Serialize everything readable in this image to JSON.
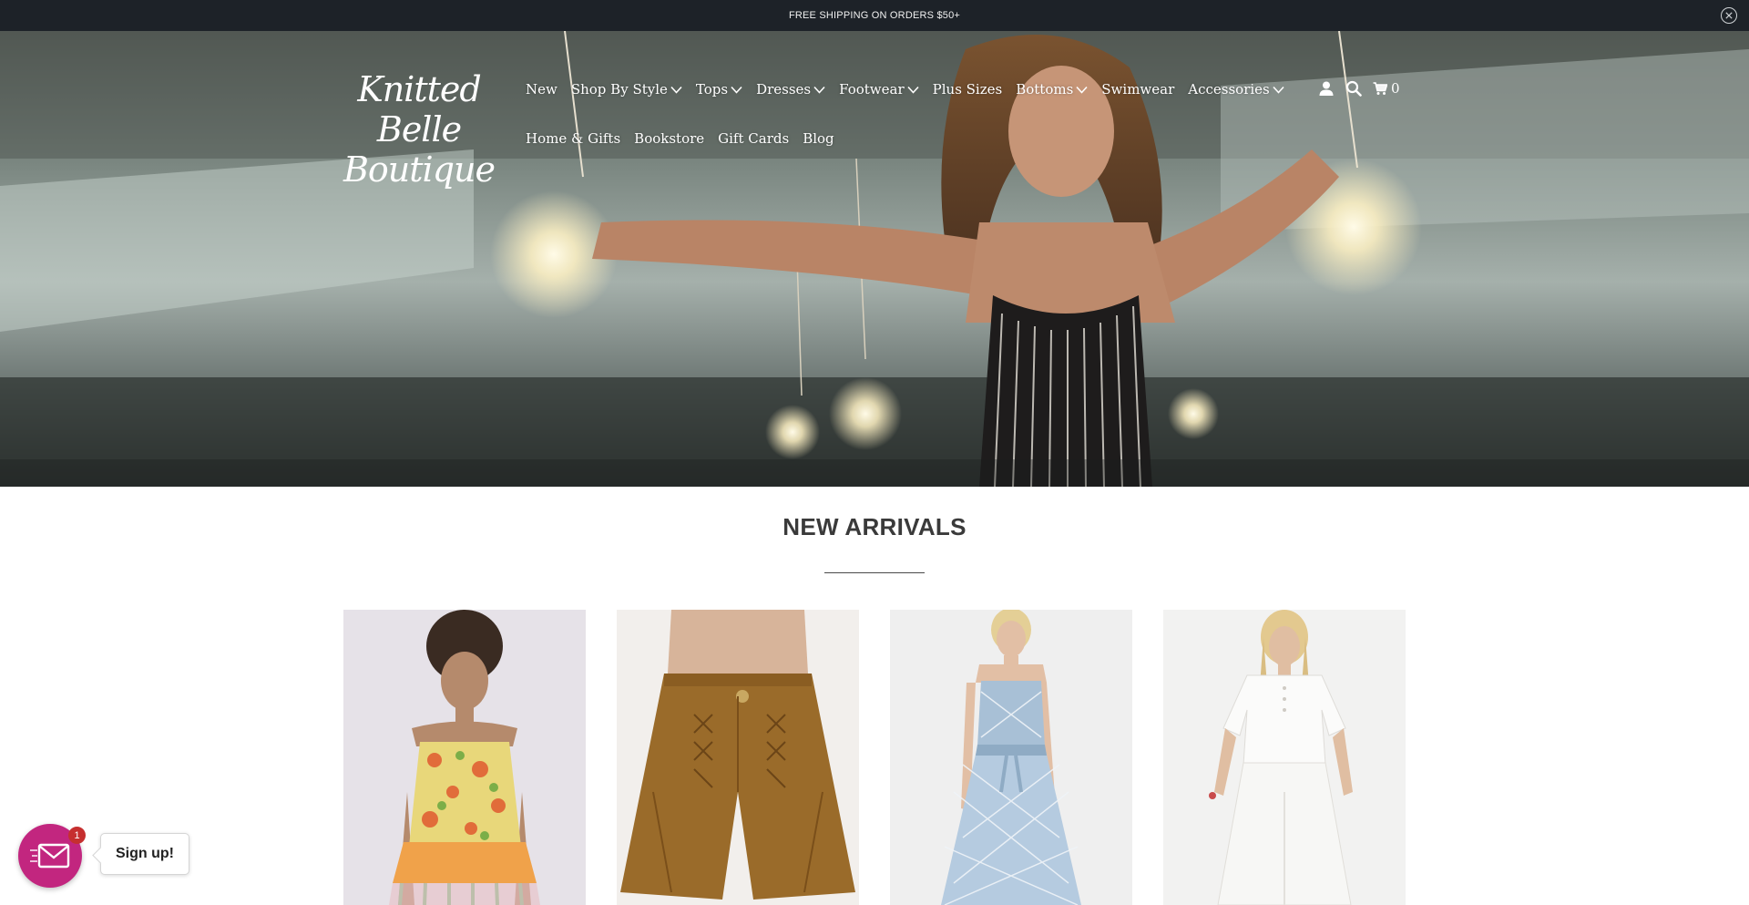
{
  "announcement": {
    "text": "FREE SHIPPING ON ORDERS $50+"
  },
  "brand": {
    "line1": "Knitted Belle",
    "line2": "Boutique"
  },
  "nav": {
    "row1": [
      {
        "label": "New",
        "dropdown": false
      },
      {
        "label": "Shop By Style",
        "dropdown": true
      },
      {
        "label": "Tops",
        "dropdown": true
      },
      {
        "label": "Dresses",
        "dropdown": true
      },
      {
        "label": "Footwear",
        "dropdown": true
      },
      {
        "label": "Plus Sizes",
        "dropdown": false
      },
      {
        "label": "Bottoms",
        "dropdown": true
      },
      {
        "label": "Swimwear",
        "dropdown": false
      },
      {
        "label": "Accessories",
        "dropdown": true
      }
    ],
    "row2": [
      {
        "label": "Home & Gifts"
      },
      {
        "label": "Bookstore"
      },
      {
        "label": "Gift Cards"
      },
      {
        "label": "Blog"
      }
    ],
    "icons": [
      "account-icon",
      "search-icon",
      "cart-icon"
    ],
    "cart_count": "0"
  },
  "section": {
    "title": "NEW ARRIVALS"
  },
  "products": [
    {
      "name": "floral-smocked-top",
      "image": "model-floral-tiered-top"
    },
    {
      "name": "suede-lace-up-shorts",
      "image": "brown-suede-shorts"
    },
    {
      "name": "blue-print-midi-dress",
      "image": "model-blue-dress"
    },
    {
      "name": "white-linen-set",
      "image": "model-white-set"
    }
  ],
  "signup": {
    "label": "Sign up!",
    "badge": "1"
  },
  "colors": {
    "announce_bg": "#1d2228",
    "signup_accent": "#c2267f",
    "badge": "#c62f2f"
  }
}
